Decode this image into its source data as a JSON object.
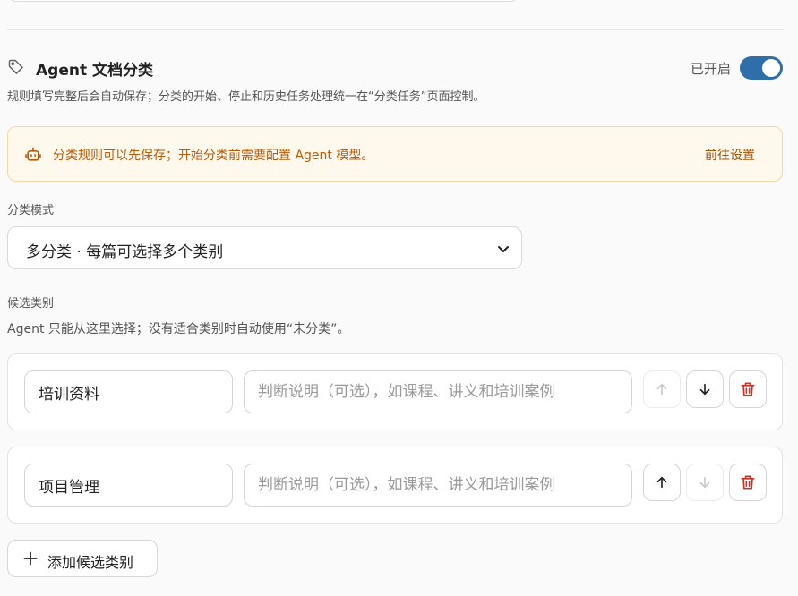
{
  "section": {
    "title": "Agent 文档分类",
    "toggle_label": "已开启",
    "toggle_on": true,
    "description": "规则填写完整后会自动保存；分类的开始、停止和历史任务处理统一在“分类任务”页面控制。",
    "icon": "tag-icon"
  },
  "notice": {
    "icon": "robot-icon",
    "text": "分类规则可以先保存；开始分类前需要配置 Agent 模型。",
    "link": "前往设置"
  },
  "mode": {
    "label": "分类模式",
    "value": "多分类 · 每篇可选择多个类别"
  },
  "candidates": {
    "label": "候选类别",
    "description": "Agent 只能从这里选择；没有适合类别时自动使用“未分类”。",
    "items": [
      {
        "name": "培训资料",
        "desc_placeholder": "判断说明（可选），如课程、讲义和培训案例",
        "up_enabled": false,
        "down_enabled": true
      },
      {
        "name": "项目管理",
        "desc_placeholder": "判断说明（可选），如课程、讲义和培训案例",
        "up_enabled": true,
        "down_enabled": false
      }
    ],
    "add_label": "添加候选类别"
  },
  "colors": {
    "accent": "#2f6ea8",
    "warning_text": "#b65c0a",
    "warning_bg": "#fff8ec",
    "danger": "#c0392b"
  }
}
